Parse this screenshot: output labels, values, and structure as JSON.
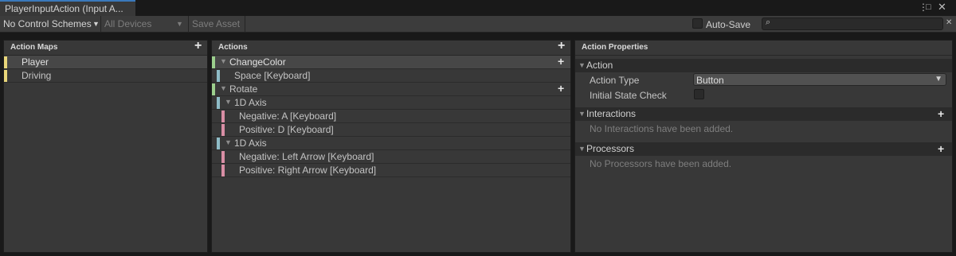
{
  "window": {
    "tab_title": "PlayerInputAction (Input A...",
    "menu_icon": "⋮",
    "maximize_icon": "□",
    "close_icon": "✕"
  },
  "toolbar": {
    "control_schemes": "No Control Schemes",
    "devices": "All Devices",
    "save_asset": "Save Asset",
    "auto_save": "Auto-Save",
    "search_placeholder": "",
    "search_icon": "⌕",
    "search_clear_icon": "✕"
  },
  "action_maps": {
    "title": "Action Maps",
    "add_icon": "+",
    "items": [
      {
        "label": "Player"
      },
      {
        "label": "Driving"
      }
    ]
  },
  "actions": {
    "title": "Actions",
    "add_icon": "+",
    "tree": [
      {
        "label": "ChangeColor"
      },
      {
        "label": "Space [Keyboard]"
      },
      {
        "label": "Rotate"
      },
      {
        "label": "1D Axis"
      },
      {
        "label": "Negative: A [Keyboard]"
      },
      {
        "label": "Positive: D [Keyboard]"
      },
      {
        "label": "1D Axis"
      },
      {
        "label": "Negative: Left Arrow [Keyboard]"
      },
      {
        "label": "Positive: Right Arrow [Keyboard]"
      }
    ]
  },
  "properties": {
    "title": "Action Properties",
    "action_section": "Action",
    "action_type_label": "Action Type",
    "action_type_value": "Button",
    "initial_state_label": "Initial State Check",
    "interactions_section": "Interactions",
    "interactions_empty": "No Interactions have been added.",
    "processors_section": "Processors",
    "processors_empty": "No Processors have been added."
  },
  "colors": {
    "action_map_bar": "#e8d67a",
    "action_bar": "#9ccf8d",
    "binding_bar": "#8fbcc7",
    "part_bar": "#d98ea5",
    "tab_accent": "#3a79bb"
  }
}
